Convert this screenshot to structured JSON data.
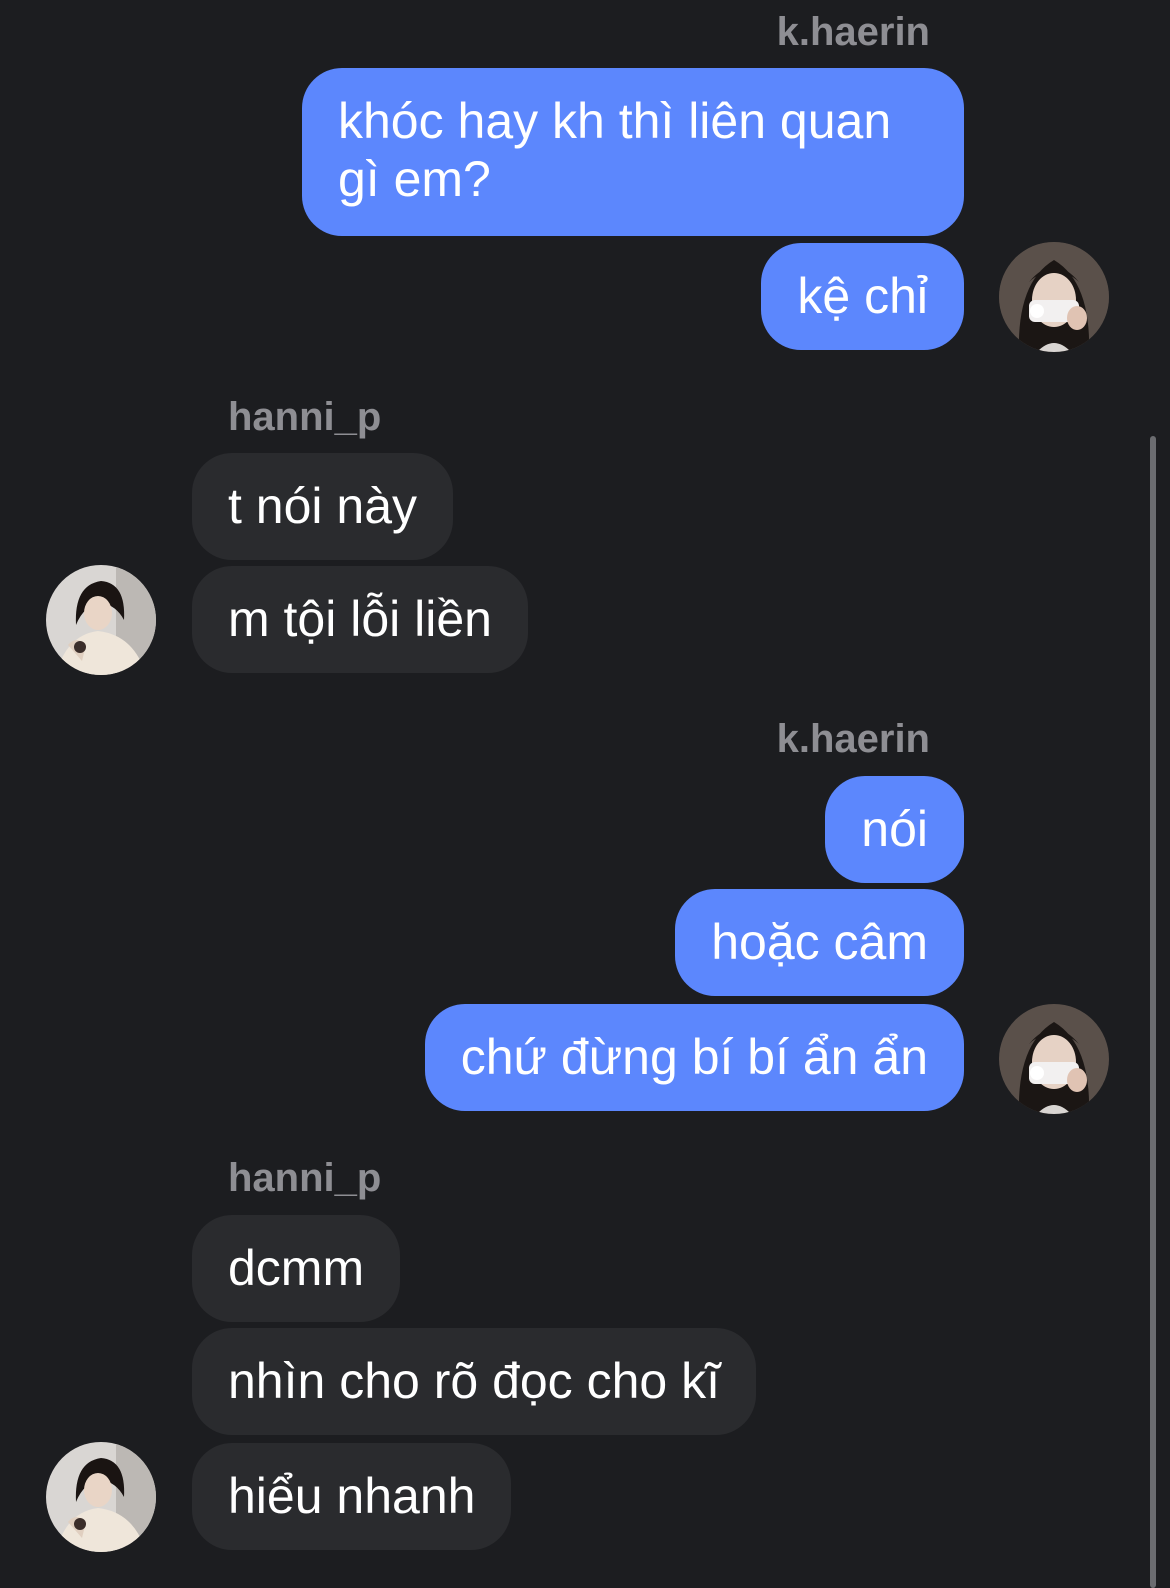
{
  "conversation": {
    "groups": [
      {
        "sender": "k.haerin",
        "side": "out",
        "messages": [
          "khóc hay kh thì liên quan gì em?",
          "kệ chỉ"
        ]
      },
      {
        "sender": "hanni_p",
        "side": "in",
        "messages": [
          "t nói này",
          "m tội lỗi liền"
        ]
      },
      {
        "sender": "k.haerin",
        "side": "out",
        "messages": [
          "nói",
          "hoặc câm",
          "chứ đừng bí bí ẩn ẩn"
        ]
      },
      {
        "sender": "hanni_p",
        "side": "in",
        "messages": [
          "dcmm",
          "nhìn cho rõ đọc cho kĩ",
          "hiểu nhanh"
        ]
      }
    ]
  },
  "colors": {
    "background": "#1c1d20",
    "outgoing_bubble": "#5c87fd",
    "incoming_bubble": "#2a2b2e",
    "sender_name": "#8e8e93"
  },
  "icons": {
    "haerin_avatar": "avatar-photo-haerin",
    "hanni_avatar": "avatar-photo-hanni"
  }
}
